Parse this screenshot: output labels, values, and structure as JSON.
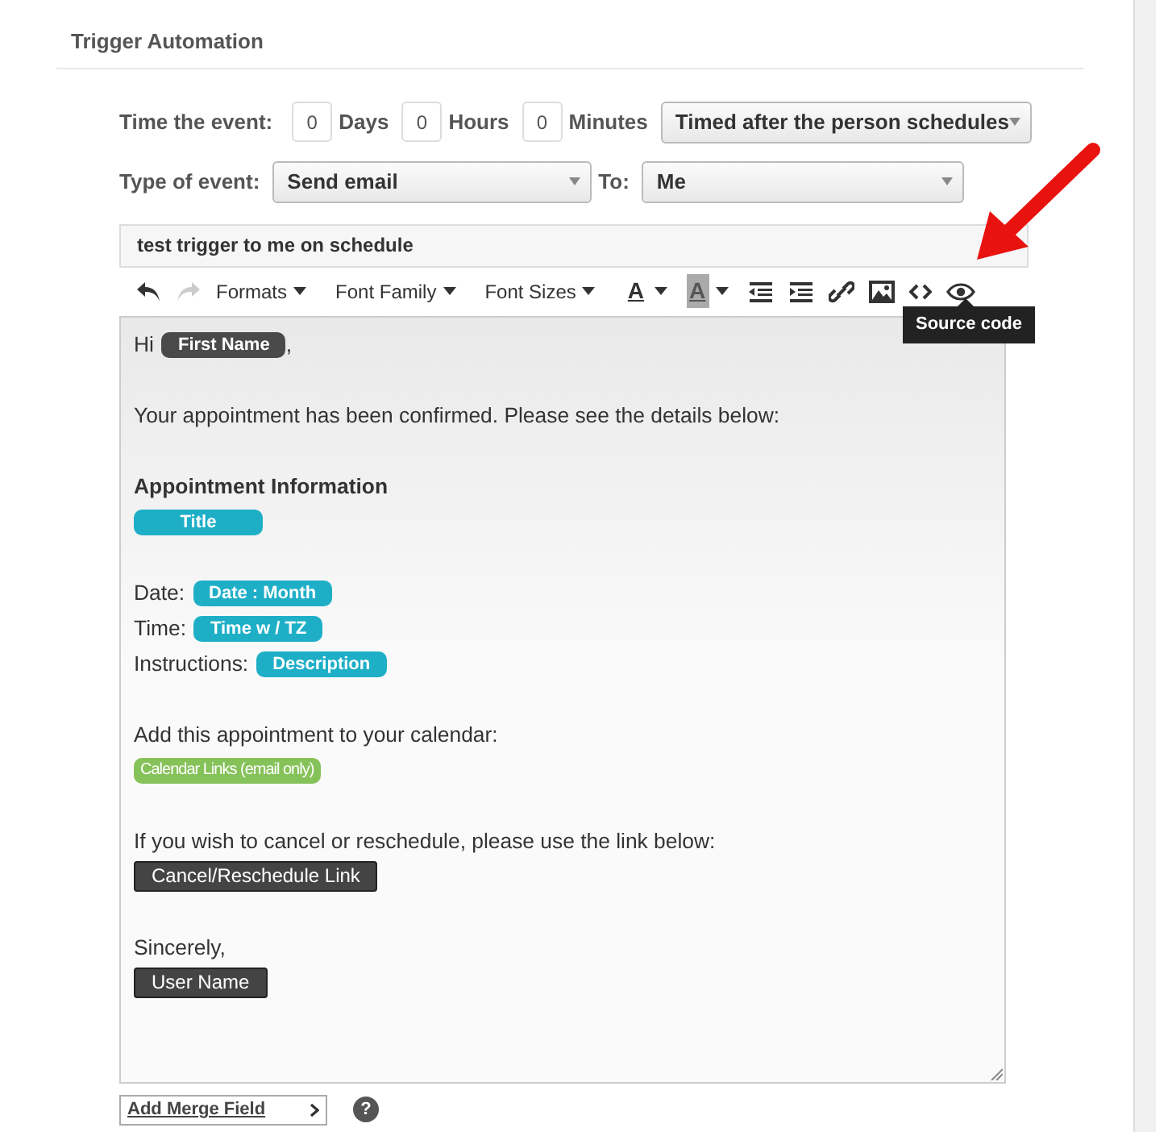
{
  "section_title": "Trigger Automation",
  "timing": {
    "label": "Time the event:",
    "fields": [
      {
        "value": "0",
        "unit": "Days"
      },
      {
        "value": "0",
        "unit": "Hours"
      },
      {
        "value": "0",
        "unit": "Minutes"
      }
    ],
    "mode": "Timed after the person schedules"
  },
  "event": {
    "label": "Type of event:",
    "type": "Send email",
    "to_label": "To:",
    "to": "Me"
  },
  "subject": "test trigger to me on schedule",
  "toolbar": [
    {
      "kind": "undo",
      "disabled": false
    },
    {
      "kind": "redo",
      "disabled": true
    },
    {
      "kind": "menu",
      "label": "Formats",
      "disabled": false
    },
    {
      "kind": "menu",
      "label": "Font Family",
      "disabled": false
    },
    {
      "kind": "menu",
      "label": "Font Sizes",
      "disabled": false
    },
    {
      "kind": "textcolor",
      "label": "A",
      "disabled": false
    },
    {
      "kind": "bgcolor",
      "label": "A",
      "disabled": false
    },
    {
      "kind": "outdent",
      "disabled": false
    },
    {
      "kind": "indent",
      "disabled": false
    },
    {
      "kind": "link",
      "disabled": false
    },
    {
      "kind": "image",
      "disabled": false
    },
    {
      "kind": "code",
      "disabled": false
    },
    {
      "kind": "preview",
      "disabled": false
    }
  ],
  "tooltip": "Source code",
  "body": [
    {
      "lines": [
        {
          "text": "Hi",
          "tag": {
            "label": "First Name",
            "kind": "pill",
            "color": "#4a4a4a"
          },
          "after": ","
        }
      ]
    },
    {
      "lines": [
        {
          "text": "Your appointment has been confirmed. Please see the details below:"
        }
      ]
    },
    {
      "lines": [
        {
          "text": "Appointment Information",
          "bold": true
        },
        {
          "tag": {
            "label": "Title",
            "kind": "wide",
            "color": "#1eafc7"
          }
        }
      ]
    },
    {
      "lines": [
        {
          "text": "Date:",
          "tag": {
            "label": "Date : Month",
            "kind": "pill",
            "color": "#1eafc7"
          }
        },
        {
          "text": "Time:",
          "tag": {
            "label": "Time w / TZ",
            "kind": "pill",
            "color": "#1eafc7"
          }
        },
        {
          "text": "Instructions:",
          "tag": {
            "label": "Description",
            "kind": "pill",
            "color": "#1eafc7"
          }
        }
      ]
    },
    {
      "lines": [
        {
          "text": "Add this appointment to your calendar:"
        },
        {
          "tag": {
            "label": "Calendar Links (email only)",
            "kind": "small",
            "color": "#86c25a"
          }
        }
      ]
    },
    {
      "lines": [
        {
          "text": "If you wish to cancel or reschedule, please use the link below:"
        },
        {
          "tag": {
            "label": "Cancel/Reschedule Link",
            "kind": "box",
            "color": "#444444"
          }
        }
      ]
    },
    {
      "lines": [
        {
          "text": "Sincerely,"
        },
        {
          "tag": {
            "label": "User Name",
            "kind": "box",
            "color": "#444444"
          }
        }
      ]
    }
  ],
  "add_merge_field": "Add Merge Field",
  "help": "?"
}
